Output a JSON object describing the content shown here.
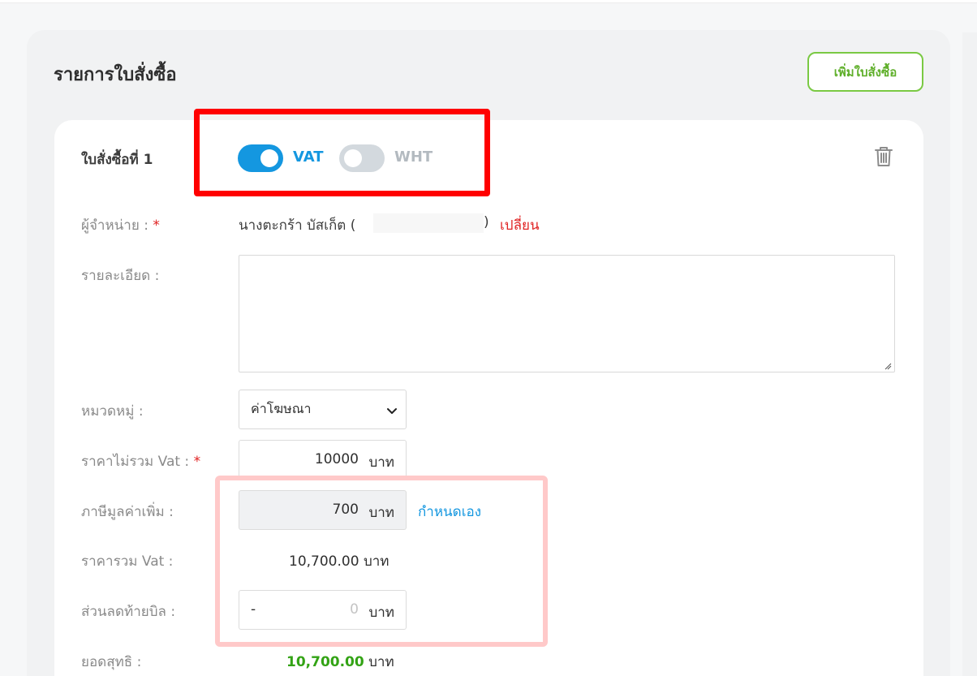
{
  "section": {
    "title": "รายการใบสั่งซื้อ",
    "add_button_label": "เพิ่มใบสั่งซื้อ"
  },
  "order": {
    "title": "ใบสั่งซื้อที่ 1",
    "vat_toggle": {
      "label": "VAT",
      "on": true,
      "color": "#1497e0"
    },
    "wht_toggle": {
      "label": "WHT",
      "on": false,
      "color": "#b3bac0"
    },
    "vendor": {
      "label": "ผู้จำหน่าย :",
      "required_mark": "*",
      "value_prefix": "นางตะกร้า บัสเก็ต (",
      "value_suffix": ")",
      "change_link": "เปลี่ยน"
    },
    "detail": {
      "label": "รายละเอียด :",
      "value": ""
    },
    "category": {
      "label": "หมวดหมู่ :",
      "selected": "ค่าโฆษณา"
    },
    "price_ex_vat": {
      "label": "ราคาไม่รวม Vat :",
      "required_mark": "*",
      "value": "10000",
      "unit": "บาท"
    },
    "vat_amount": {
      "label": "ภาษีมูลค่าเพิ่ม :",
      "value": "700",
      "unit": "บาท",
      "custom_link": "กำหนดเอง"
    },
    "total_incl_vat": {
      "label": "ราคารวม Vat :",
      "value": "10,700.00",
      "unit": "บาท"
    },
    "discount": {
      "label": "ส่วนลดท้ายบิล :",
      "prefix": "-",
      "placeholder": "0",
      "unit": "บาท"
    },
    "net_total": {
      "label": "ยอดสุทธิ :",
      "value": "10,700.00",
      "unit": "บาท"
    }
  },
  "colors": {
    "accent_blue": "#1497e0",
    "accent_green": "#7ac943",
    "net_green": "#33a315",
    "link_red": "#e02424",
    "highlight_red": "#ff0000",
    "highlight_pink": "#ffc9c9"
  },
  "icons": {
    "delete": "trash-icon",
    "dropdown": "chevron-down-icon",
    "resize": "resize-grip-icon"
  }
}
